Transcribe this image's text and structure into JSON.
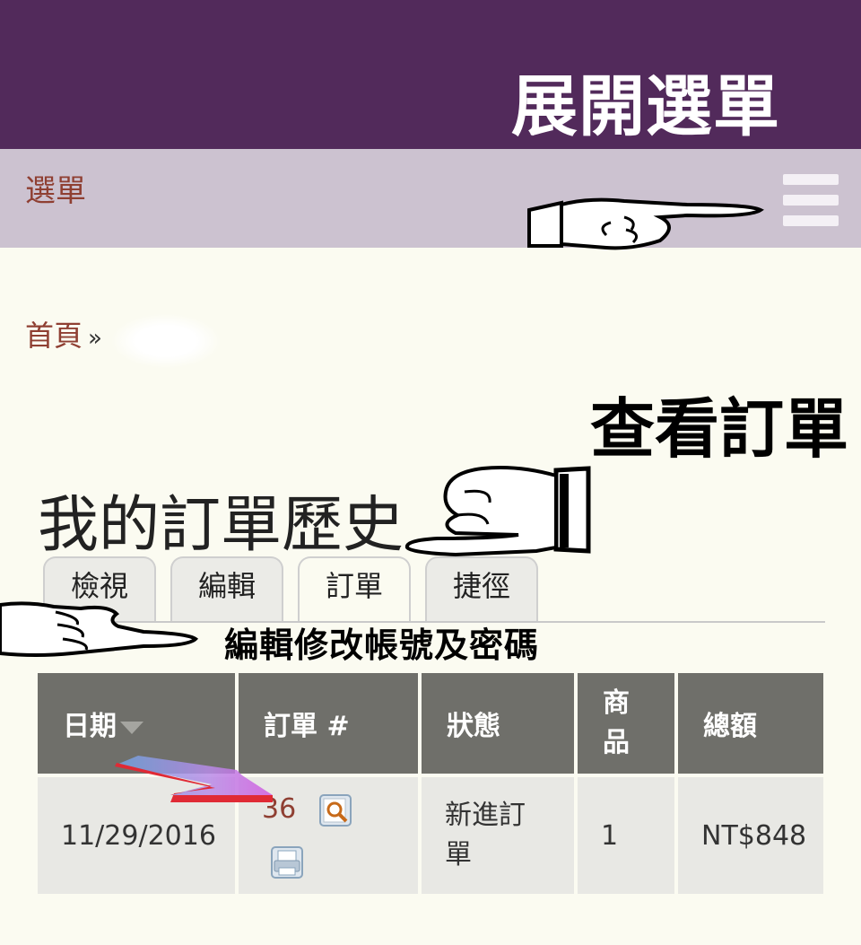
{
  "annotations": {
    "expand_menu": "展開選單",
    "view_orders": "查看訂單",
    "edit_account": "編輯修改帳號及密碼"
  },
  "menu": {
    "label": "選單",
    "hamburger_icon": "hamburger-icon"
  },
  "breadcrumb": {
    "home": "首頁",
    "separator": "»"
  },
  "page": {
    "title": "我的訂單歷史"
  },
  "tabs": [
    {
      "label": "檢視",
      "active": false
    },
    {
      "label": "編輯",
      "active": false
    },
    {
      "label": "訂單",
      "active": true
    },
    {
      "label": "捷徑",
      "active": false
    }
  ],
  "orders_table": {
    "headers": {
      "date": "日期",
      "order": "訂單 #",
      "status": "狀態",
      "items": "商品",
      "total": "總額"
    },
    "rows": [
      {
        "date": "11/29/2016",
        "order_number": "36",
        "status": "新進訂單",
        "items": "1",
        "total": "NT$848"
      }
    ]
  },
  "colors": {
    "topbar": "#522a5b",
    "menubar": "#ccc2d0",
    "link": "#8f3f32",
    "table_header": "#6f6f6a",
    "table_cell": "#e8e8e4",
    "page_bg": "#fbfbf1"
  }
}
